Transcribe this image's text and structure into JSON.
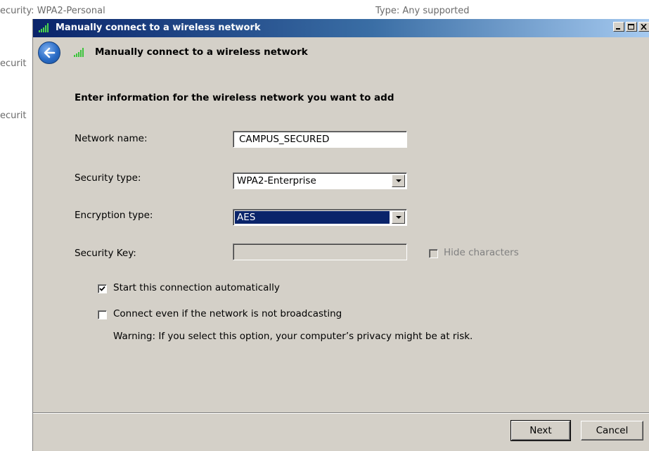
{
  "background": {
    "security_text": "ecurity: WPA2-Personal",
    "type_text": "Type: Any supported",
    "fragment_1": "ecurit",
    "fragment_2": "ecurit"
  },
  "window": {
    "title": "Manually connect to a wireless network",
    "controls": {
      "minimize": "minimize-icon",
      "maximize": "maximize-icon",
      "close": "close-icon"
    }
  },
  "header": {
    "title": "Manually connect to a wireless network",
    "back_icon": "back-arrow-icon",
    "network_icon": "wireless-signal-icon"
  },
  "form": {
    "section_title": "Enter information for the wireless network you want to add",
    "network_name": {
      "label": "Network name:",
      "value": "CAMPUS_SECURED"
    },
    "security_type": {
      "label": "Security type:",
      "value": "WPA2-Enterprise"
    },
    "encryption_type": {
      "label": "Encryption type:",
      "value": "AES"
    },
    "security_key": {
      "label": "Security Key:",
      "value": "",
      "hide_characters_label": "Hide characters",
      "hide_characters_checked": false
    },
    "start_automatically": {
      "label": "Start this connection automatically",
      "checked": true
    },
    "connect_not_broadcasting": {
      "label": "Connect even if the network is not broadcasting",
      "checked": false
    },
    "warning": "Warning: If you select this option, your computer’s privacy might be at risk."
  },
  "buttons": {
    "next": "Next",
    "cancel": "Cancel"
  },
  "colors": {
    "dialog_bg": "#d4d0c8",
    "selection": "#0a246a",
    "titlebar_start": "#0a246a",
    "titlebar_end": "#a6caf0"
  }
}
